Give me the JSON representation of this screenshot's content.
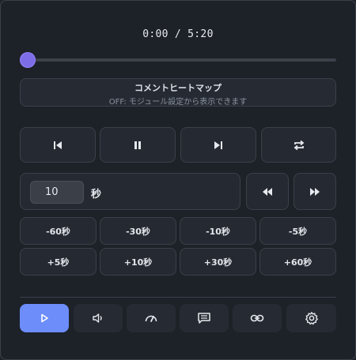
{
  "player": {
    "time_display": "0:00 / 5:20",
    "progress": 0.0
  },
  "heatmap": {
    "title": "コメントヒートマップ",
    "status": "OFF: モジュール設定から表示できます"
  },
  "transport": {
    "buttons": [
      "skip-previous-icon",
      "pause-icon",
      "skip-next-icon",
      "repeat-icon"
    ]
  },
  "skip": {
    "value": "10",
    "unit": "秒",
    "buttons": [
      "rewind-icon",
      "fast-forward-icon"
    ]
  },
  "seek_buttons": {
    "row1": [
      "-60秒",
      "-30秒",
      "-10秒",
      "-5秒"
    ],
    "row2": [
      "+5秒",
      "+10秒",
      "+30秒",
      "+60秒"
    ]
  },
  "tabs": {
    "items": [
      "play-icon",
      "volume-icon",
      "speedometer-icon",
      "comment-icon",
      "link-icon",
      "settings-icon"
    ],
    "active_color": "#6d8dfb"
  },
  "colors": {
    "accent": "#7d6ee8",
    "background": "#1d2128"
  }
}
